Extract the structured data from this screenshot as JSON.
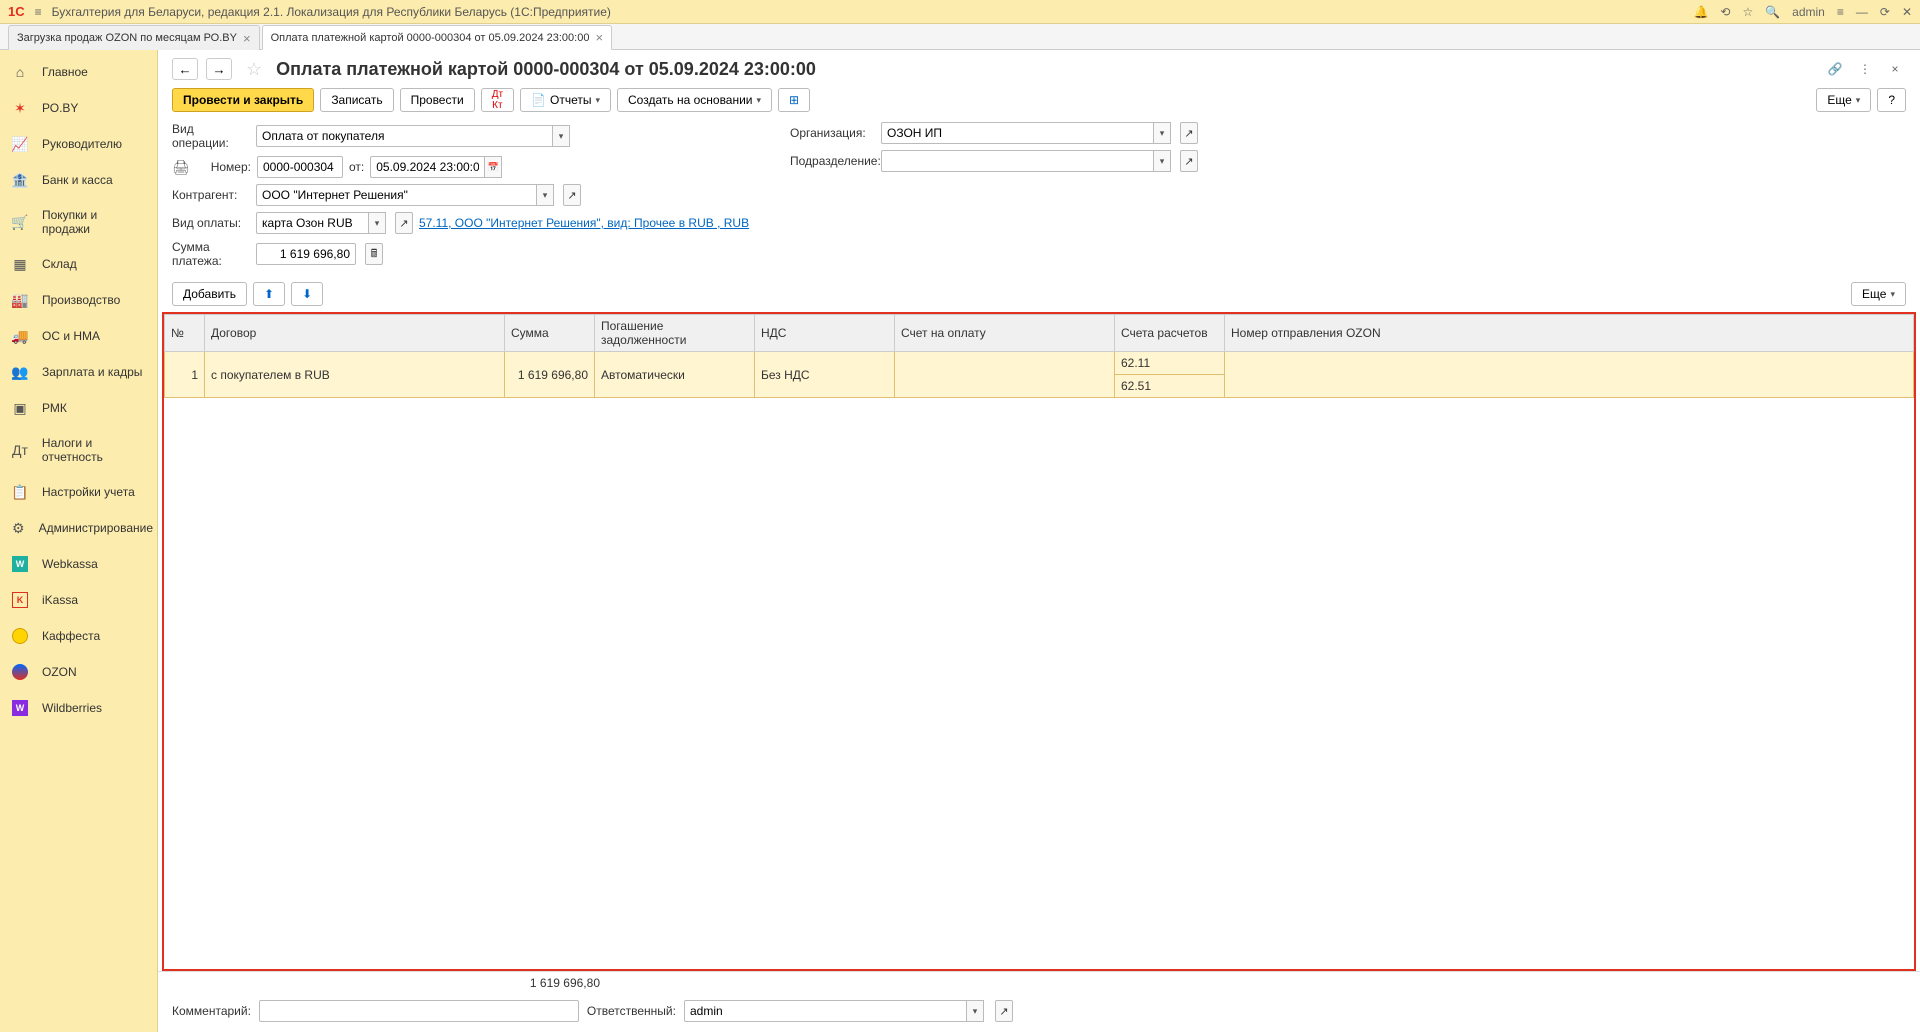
{
  "titlebar": {
    "app_title": "Бухгалтерия для Беларуси, редакция 2.1. Локализация для Республики Беларусь  (1С:Предприятие)",
    "user": "admin"
  },
  "tabs": [
    {
      "label": "Загрузка продаж OZON по месяцам РО.BY",
      "active": false
    },
    {
      "label": "Оплата платежной картой 0000-000304 от 05.09.2024 23:00:00",
      "active": true
    }
  ],
  "sidebar": {
    "items": [
      {
        "label": "Главное",
        "icon": "home"
      },
      {
        "label": "РО.BY",
        "icon": "poby"
      },
      {
        "label": "Руководителю",
        "icon": "chart"
      },
      {
        "label": "Банк и касса",
        "icon": "bank"
      },
      {
        "label": "Покупки и продажи",
        "icon": "cart"
      },
      {
        "label": "Склад",
        "icon": "grid"
      },
      {
        "label": "Производство",
        "icon": "factory"
      },
      {
        "label": "ОС и НМА",
        "icon": "truck"
      },
      {
        "label": "Зарплата и кадры",
        "icon": "people"
      },
      {
        "label": "РМК",
        "icon": "rmk"
      },
      {
        "label": "Налоги и отчетность",
        "icon": "tax"
      },
      {
        "label": "Настройки учета",
        "icon": "calendar"
      },
      {
        "label": "Администрирование",
        "icon": "gear"
      },
      {
        "label": "Webkassa",
        "icon": "wteal"
      },
      {
        "label": "iKassa",
        "icon": "kred"
      },
      {
        "label": "Каффеста",
        "icon": "yellow"
      },
      {
        "label": "OZON",
        "icon": "ozon"
      },
      {
        "label": "Wildberries",
        "icon": "wb"
      }
    ]
  },
  "page": {
    "title": "Оплата платежной картой 0000-000304 от 05.09.2024 23:00:00",
    "toolbar": {
      "post_close": "Провести и закрыть",
      "write": "Записать",
      "post": "Провести",
      "reports": "Отчеты",
      "create_based": "Создать на основании",
      "more": "Еще"
    },
    "form": {
      "op_type_label": "Вид операции:",
      "op_type_value": "Оплата от покупателя",
      "number_label": "Номер:",
      "number_value": "0000-000304",
      "date_label": "от:",
      "date_value": "05.09.2024 23:00:00",
      "org_label": "Организация:",
      "org_value": "ОЗОН ИП",
      "dept_label": "Подразделение:",
      "dept_value": "",
      "counterparty_label": "Контрагент:",
      "counterparty_value": "ООО \"Интернет Решения\"",
      "pay_type_label": "Вид оплаты:",
      "pay_type_value": "карта Озон RUB",
      "pay_link": "57.11, ООО \"Интернет Решения\", вид: Прочее в RUB , RUB",
      "amount_label": "Сумма платежа:",
      "amount_value": "1 619 696,80"
    },
    "table_toolbar": {
      "add": "Добавить",
      "more": "Еще"
    },
    "table": {
      "headers": [
        "№",
        "Договор",
        "Сумма",
        "Погашение задолженности",
        "НДС",
        "Счет на оплату",
        "Счета расчетов",
        "Номер отправления OZON"
      ],
      "row": {
        "n": "1",
        "contract": "с покупателем в RUB",
        "sum": "1 619 696,80",
        "repayment": "Автоматически",
        "vat": "Без НДС",
        "invoice": "",
        "acc1": "62.11",
        "acc2": "62.51",
        "ozon_num": ""
      }
    },
    "footer_total": "1 619 696,80",
    "bottom": {
      "comment_label": "Комментарий:",
      "comment_value": "",
      "responsible_label": "Ответственный:",
      "responsible_value": "admin"
    }
  }
}
